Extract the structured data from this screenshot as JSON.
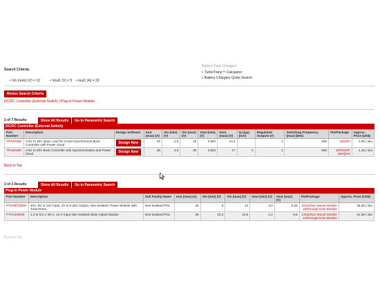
{
  "criteria": {
    "title": "Search Criteria:",
    "vin_nom": "• Vin (nom) (V) = 12",
    "vout1": "• Vout1 (V) = 5",
    "iout1": "• Iout1 (A) = 20"
  },
  "sidebar": {
    "partial_top": "Battery Pack Chargers",
    "items": [
      "TurboTrans™ Calculator",
      "Battery Chargers Quick Search"
    ]
  },
  "revise_label": "Revise Search Criteria",
  "anchors": "DC/DC Controller (External Switch) | Plug-in Power Module",
  "section1": {
    "count": "2 of 7 Results",
    "show_all": "Show All Results",
    "parametric": "Go to Parametric Search",
    "title": "DC/DC Controller (External Switch)",
    "headers": [
      "Part Number",
      "Description",
      "Design Software",
      "Iout (max) (A)",
      "Vin (min) (V)",
      "Vin (max) (V)",
      "Vout (min) (V)",
      "Vout (max) (V)",
      "Iq (typ) (mA)",
      "Regulated Outputs (#)",
      "Switching Frequency (max) (kHz)",
      "Pin/Package",
      "Approx. Price (US$)"
    ],
    "rows": [
      {
        "part": "TPS40193",
        "desc": "4.5V to 18V Input, Low Pin Count Synchronous Buck Controller with Power Good",
        "design": "Design Now",
        "iout": "20",
        "vinmin": "4.5",
        "vinmax": "18",
        "voutmin": "0.591",
        "voutmax": "14.4",
        "iq": "",
        "outputs": "1",
        "fsw": "300",
        "pkg": "10SON",
        "price": "1.05 | 1ku"
      },
      {
        "part": "TPS40195",
        "desc": "4.5V to 20V Buck Controller with Synchronization and Power Good",
        "design": "Design Now",
        "iout": "20",
        "vinmin": "4.5",
        "vinmax": "20",
        "voutmin": "0.591",
        "voutmax": "17",
        "iq": "4",
        "outputs": "1",
        "fsw": "600",
        "pkg": "16TSSOP 16VQFN",
        "price": "1.15 | 1ku"
      }
    ]
  },
  "back_to_top": "Back to Top",
  "section2": {
    "count": "2 of 3 Results",
    "show_all": "Show All Results",
    "parametric": "Go to Parametric Search",
    "title": "Plug-in Power Module",
    "headers": [
      "Part Number",
      "Description",
      "Sub Family Name",
      "Iout (max) (A)",
      "Vin (min) (V)",
      "Vin (max) (V)",
      "Vout (min) (V)",
      "Vout (max) (V)",
      "Pin/Package",
      "Approx. Price (US$)"
    ],
    "rows": [
      {
        "part": "PTH08T205W",
        "desc": "40A, 8V to 14V Input, 3V to 5.25V Output, Non-Isolated, Power Module with TurboTrans",
        "sub": "Non-Isolated POL",
        "iout": "40",
        "vinmin": "8",
        "vinmax": "14",
        "voutmin": "3.0",
        "voutmax": "5.25",
        "pkg1": "22Surface Mount Module",
        "pkg2": "22Through-Hole Module",
        "price": "36.00 | 1ku"
      },
      {
        "part": "PTH12030W",
        "desc": "1.2 to 5.5 V 26-A, 12-V Input Non-Isolated Wide-Adjust Module",
        "sub": "Non-Isolated POL",
        "iout": "26",
        "vinmin": "10.2",
        "vinmax": "13.8",
        "voutmin": "1.2",
        "voutmax": "5.5",
        "pkg1": "13Surface Mount Module",
        "pkg2": "13Through-Hole Module",
        "price": "21.25 | 1ku"
      }
    ]
  },
  "bottom_partial": "Back to Top"
}
